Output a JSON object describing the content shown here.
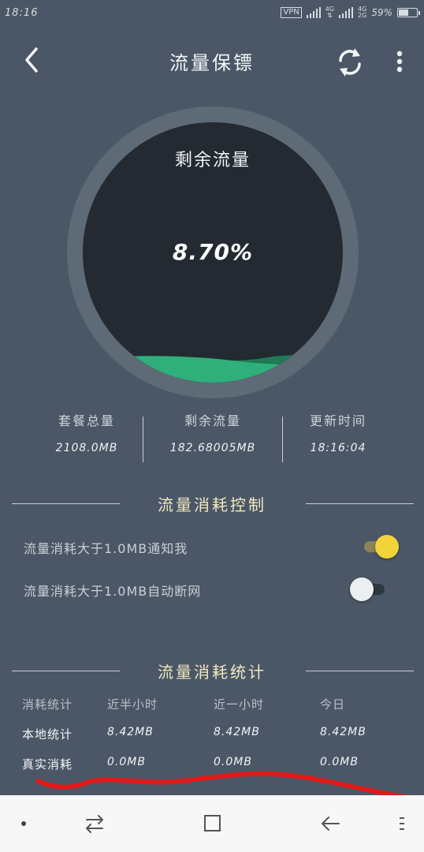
{
  "status_bar": {
    "time": "18:16",
    "vpn": "VPN",
    "net1": "4G",
    "net2_top": "4G",
    "net2_bottom": "2G",
    "battery": "59%",
    "battery_level": 0.59
  },
  "app_bar": {
    "title": "流量保镖",
    "back_icon": "chevron-left-icon",
    "refresh_icon": "refresh-icon",
    "menu_icon": "more-vertical-icon"
  },
  "gauge": {
    "label": "剩余流量",
    "value": "8.70%",
    "fill_fraction": 0.087,
    "colors": {
      "ring": "#5e6a76",
      "inner": "#232a31",
      "wave_front": "#2fb07a",
      "wave_back": "#1f7a55"
    }
  },
  "stats": [
    {
      "label": "套餐总量",
      "value": "2108.0MB"
    },
    {
      "label": "剩余流量",
      "value": "182.68005MB"
    },
    {
      "label": "更新时间",
      "value": "18:16:04"
    }
  ],
  "control_section": {
    "title": "流量消耗控制",
    "settings": [
      {
        "label": "流量消耗大于1.0MB通知我",
        "enabled": true
      },
      {
        "label": "流量消耗大于1.0MB自动断网",
        "enabled": false
      }
    ],
    "colors": {
      "toggle_on_thumb": "#f2d33a",
      "toggle_on_track": "#8a8456",
      "toggle_off_thumb": "#eceff1",
      "toggle_off_track": "#2f3740"
    }
  },
  "stats_section": {
    "title": "流量消耗统计",
    "headers": [
      "消耗统计",
      "近半小时",
      "近一小时",
      "今日"
    ],
    "rows": [
      [
        "本地统计",
        "8.42MB",
        "8.42MB",
        "8.42MB"
      ],
      [
        "真实消耗",
        "0.0MB",
        "0.0MB",
        "0.0MB"
      ]
    ]
  },
  "nav_bar": {
    "items": [
      "dot-icon",
      "switch-icon",
      "square-icon",
      "back-arrow-icon",
      "menu-icon"
    ]
  },
  "annotation": {
    "color": "#e01818"
  }
}
